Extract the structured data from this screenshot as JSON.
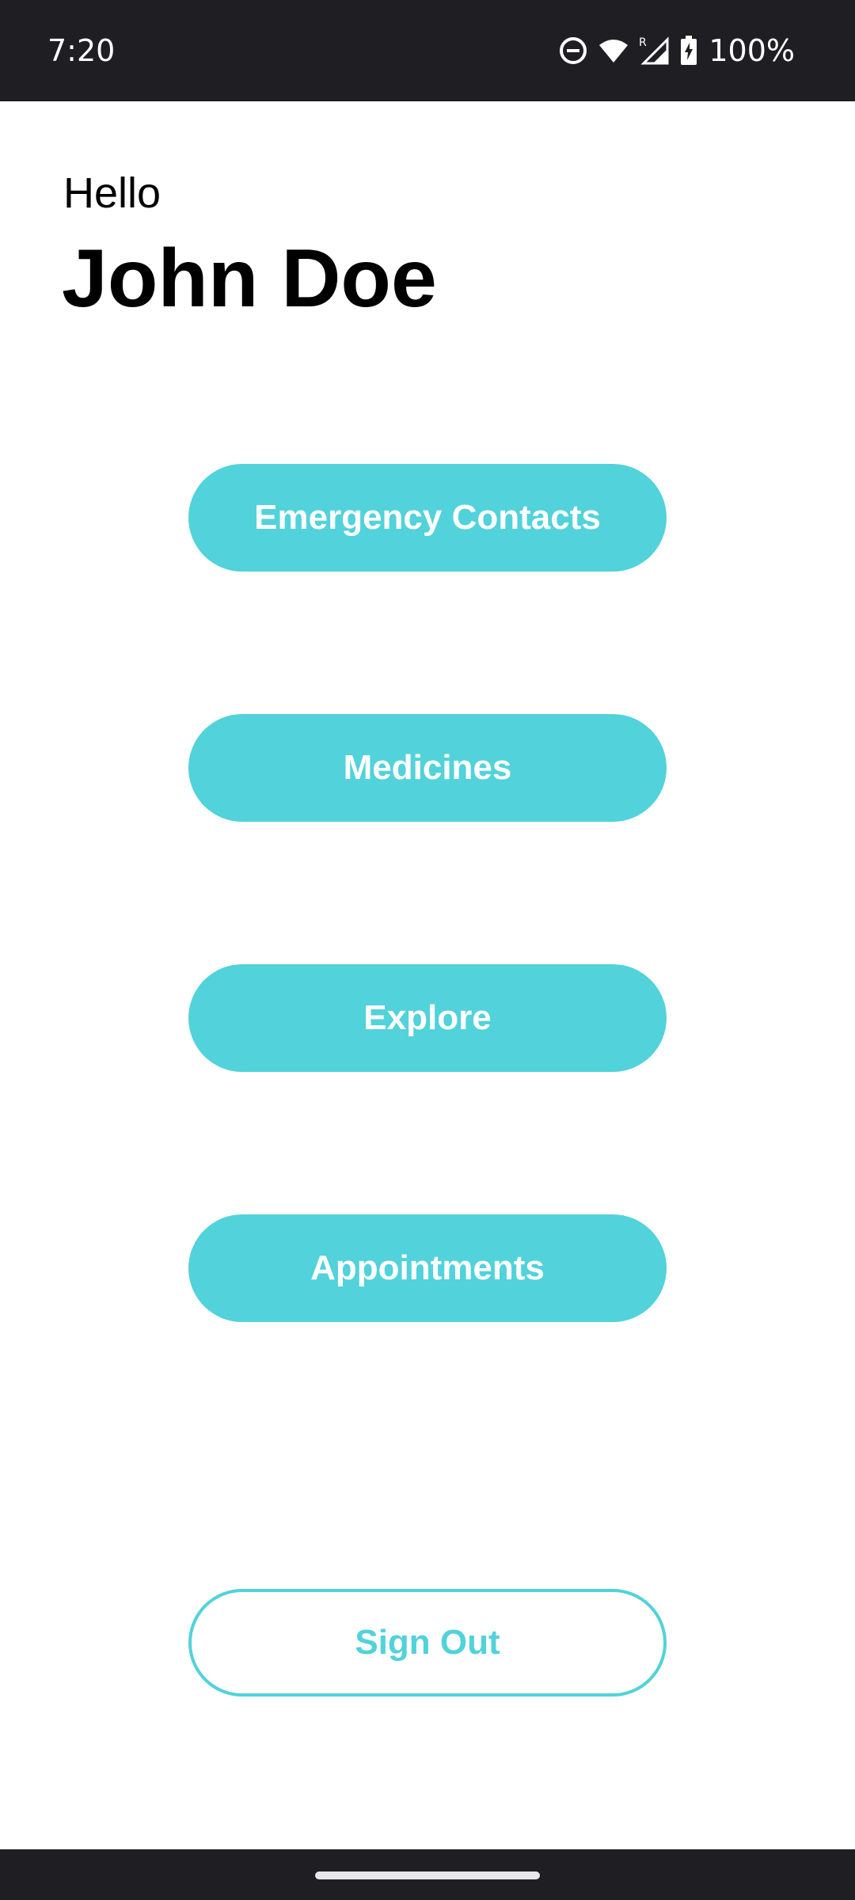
{
  "status_bar": {
    "time": "7:20",
    "battery_percent": "100%",
    "icons": [
      "do-not-disturb-icon",
      "wifi-icon",
      "signal-roaming-icon",
      "battery-charging-icon"
    ]
  },
  "header": {
    "greeting": "Hello",
    "user_name": "John Doe"
  },
  "menu": {
    "buttons": [
      {
        "label": "Emergency Contacts"
      },
      {
        "label": "Medicines"
      },
      {
        "label": "Explore"
      },
      {
        "label": "Appointments"
      }
    ]
  },
  "footer": {
    "sign_out_label": "Sign Out"
  },
  "colors": {
    "accent": "#52d2da",
    "status_bar_bg": "#1f1f23",
    "background": "#ffffff"
  }
}
